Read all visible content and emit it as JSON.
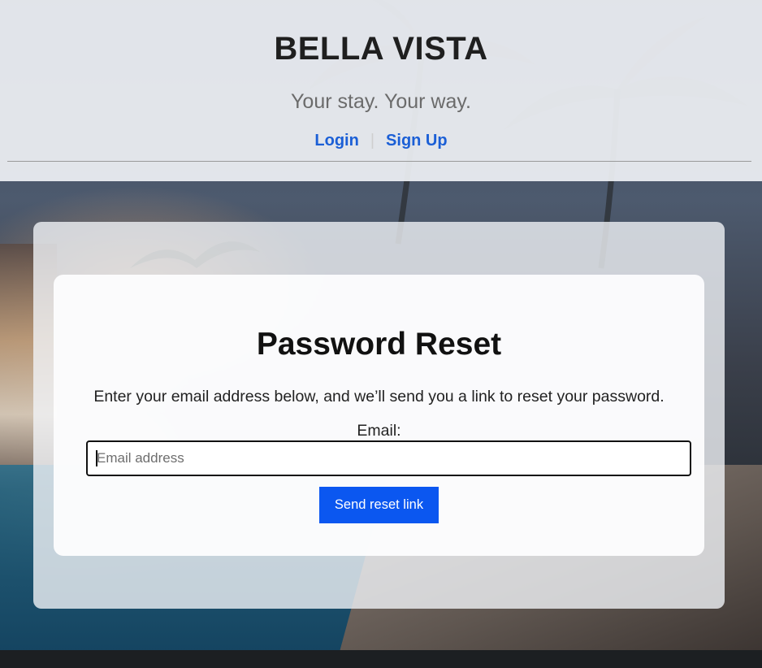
{
  "header": {
    "brand": "BELLA VISTA",
    "tagline": "Your stay. Your way.",
    "nav": {
      "login": "Login",
      "separator": "|",
      "signup": "Sign Up"
    }
  },
  "reset": {
    "title": "Password Reset",
    "description": "Enter your email address below, and we’ll send you a link to reset your password.",
    "email_label": "Email:",
    "email_value": "",
    "email_placeholder": "Email address",
    "submit_label": "Send reset link"
  },
  "colors": {
    "link": "#1b5fd6",
    "button": "#0b57f0"
  }
}
